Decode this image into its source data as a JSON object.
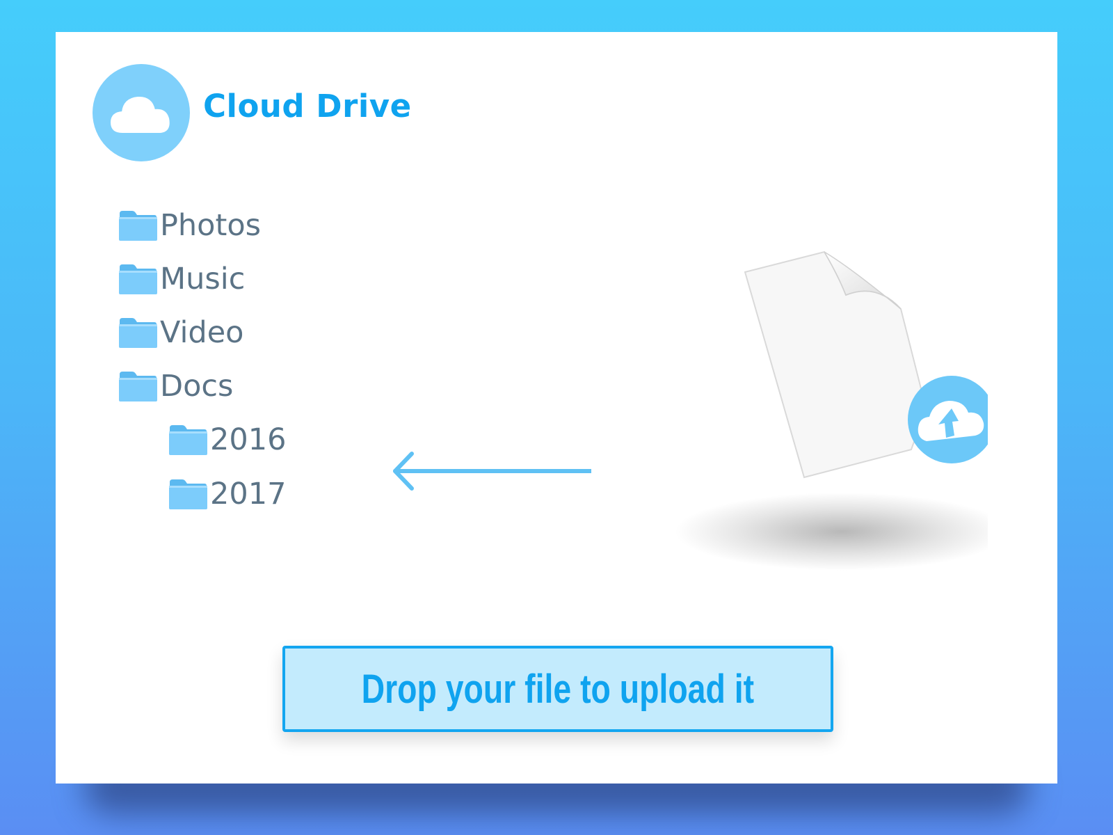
{
  "app": {
    "title": "Cloud Drive",
    "logo_icon": "cloud-icon",
    "accent_color": "#0fa3ef",
    "light_accent_color": "#7fd0fb"
  },
  "folders": [
    {
      "label": "Photos",
      "icon": "folder-icon"
    },
    {
      "label": "Music",
      "icon": "folder-icon"
    },
    {
      "label": "Video",
      "icon": "folder-icon"
    },
    {
      "label": "Docs",
      "icon": "folder-icon",
      "children": [
        {
          "label": "2016",
          "icon": "folder-icon"
        },
        {
          "label": "2017",
          "icon": "folder-icon"
        }
      ]
    }
  ],
  "dragged_file": {
    "icon": "file-icon",
    "badge_icon": "cloud-upload-icon"
  },
  "drag_indicator": {
    "icon": "arrow-left-icon"
  },
  "drop_zone": {
    "label": "Drop your file to upload it"
  }
}
